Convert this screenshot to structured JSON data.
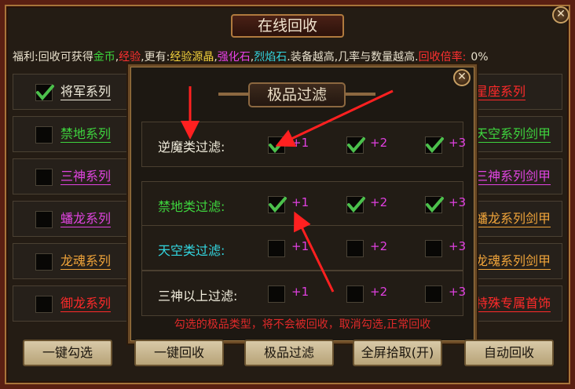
{
  "window": {
    "title": "在线回收"
  },
  "benefit": {
    "prefix": "福利:回收可获得",
    "gold": "金币",
    "comma1": ",",
    "exp": "经验",
    "more": ",更有:",
    "exp_crystal": "经验源晶",
    "comma2": ",",
    "strengthen_stone": "强化石",
    "comma3": ",",
    "flame_stone": "烈焰石",
    "suffix": ".装备越高,几率与数量越高.",
    "rate_label": "回收倍率:",
    "rate_value": "0%"
  },
  "left_series": [
    {
      "label": "将军系列",
      "checked": true,
      "color": "#f0ecdc"
    },
    {
      "label": "禁地系列",
      "checked": false,
      "color": "#3ed43e"
    },
    {
      "label": "三神系列",
      "checked": false,
      "color": "#e044e0"
    },
    {
      "label": "蟠龙系列",
      "checked": false,
      "color": "#e044e0"
    },
    {
      "label": "龙魂系列",
      "checked": false,
      "color": "#f0a43a"
    },
    {
      "label": "御龙系列",
      "checked": false,
      "color": "#ff2a2a"
    }
  ],
  "right_series": [
    {
      "label": "星座系列",
      "color": "#ff2a2a"
    },
    {
      "label": "天空系列剑甲",
      "color": "#3ed43e"
    },
    {
      "label": "三神系列剑甲",
      "color": "#e044e0"
    },
    {
      "label": "蟠龙系列剑甲",
      "color": "#f0a43a"
    },
    {
      "label": "龙魂系列剑甲",
      "color": "#f0a43a"
    },
    {
      "label": "特殊专属首饰",
      "color": "#ff2a2a"
    }
  ],
  "popup": {
    "title": "极品过滤",
    "rows": [
      {
        "label": "逆魔类过滤:",
        "color": "#f0ecdc",
        "levels": [
          "+1",
          "+2",
          "+3"
        ],
        "checked": [
          true,
          true,
          true
        ]
      },
      {
        "label": "禁地类过滤:",
        "color": "#3ed43e",
        "levels": [
          "+1",
          "+2",
          "+3"
        ],
        "checked": [
          true,
          true,
          true
        ]
      },
      {
        "label": "天空类过滤:",
        "color": "#33d6e0",
        "levels": [
          "+1",
          "+2",
          "+3"
        ],
        "checked": [
          false,
          false,
          false
        ]
      },
      {
        "label": "三神以上过滤:",
        "color": "#f0ecdc",
        "levels": [
          "+1",
          "+2",
          "+3"
        ],
        "checked": [
          false,
          false,
          false
        ]
      }
    ],
    "notice": "勾选的极品类型，将不会被回收，取消勾选,正常回收"
  },
  "buttons": {
    "select_all": "一键勾选",
    "recycle_all": "一键回收",
    "premium_filter": "极品过滤",
    "fullscreen_pickup": "全屏拾取(开)",
    "auto_recycle": "自动回收"
  },
  "colors": {
    "accent_red": "#ff2020",
    "check_green": "#4cc04c"
  }
}
